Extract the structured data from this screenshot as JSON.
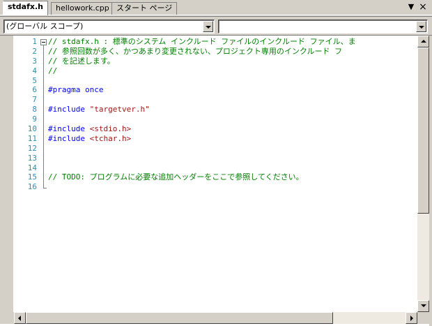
{
  "tabs": [
    {
      "label": "stdafx.h",
      "active": true
    },
    {
      "label": "hellowork.cpp",
      "active": false
    },
    {
      "label": "スタート ページ",
      "active": false
    }
  ],
  "tab_controls": {
    "overflow_icon": "triangle-down-icon",
    "close_icon": "close-icon",
    "overflow_glyph": "▼",
    "close_glyph": "×"
  },
  "scope_dropdown": {
    "value": "(グローバル スコープ)"
  },
  "member_dropdown": {
    "value": ""
  },
  "editor": {
    "line_numbers": [
      "1",
      "2",
      "3",
      "4",
      "5",
      "6",
      "7",
      "8",
      "9",
      "10",
      "11",
      "12",
      "13",
      "14",
      "15",
      "16"
    ],
    "lines": [
      [
        {
          "t": "// stdafx.h : 標準のシステム インクルード ファイルのインクルード ファイル、ま",
          "c": "cmt"
        }
      ],
      [
        {
          "t": "// 参照回数が多く、かつあまり変更されない、プロジェクト専用のインクルード フ",
          "c": "cmt"
        }
      ],
      [
        {
          "t": "// を記述します。",
          "c": "cmt"
        }
      ],
      [
        {
          "t": "//",
          "c": "cmt"
        }
      ],
      [],
      [
        {
          "t": "#pragma once",
          "c": "kw"
        }
      ],
      [],
      [
        {
          "t": "#include ",
          "c": "kw"
        },
        {
          "t": "\"targetver.h\"",
          "c": "str"
        }
      ],
      [],
      [
        {
          "t": "#include ",
          "c": "kw"
        },
        {
          "t": "<stdio.h>",
          "c": "hdr"
        }
      ],
      [
        {
          "t": "#include ",
          "c": "kw"
        },
        {
          "t": "<tchar.h>",
          "c": "hdr"
        }
      ],
      [],
      [],
      [],
      [
        {
          "t": "// TODO: プログラムに必要な追加ヘッダーをここで参照してください。",
          "c": "cmt"
        }
      ],
      []
    ]
  },
  "colors": {
    "comment": "#008000",
    "keyword": "#0000ff",
    "string": "#a31515",
    "line_number": "#2b91af"
  }
}
